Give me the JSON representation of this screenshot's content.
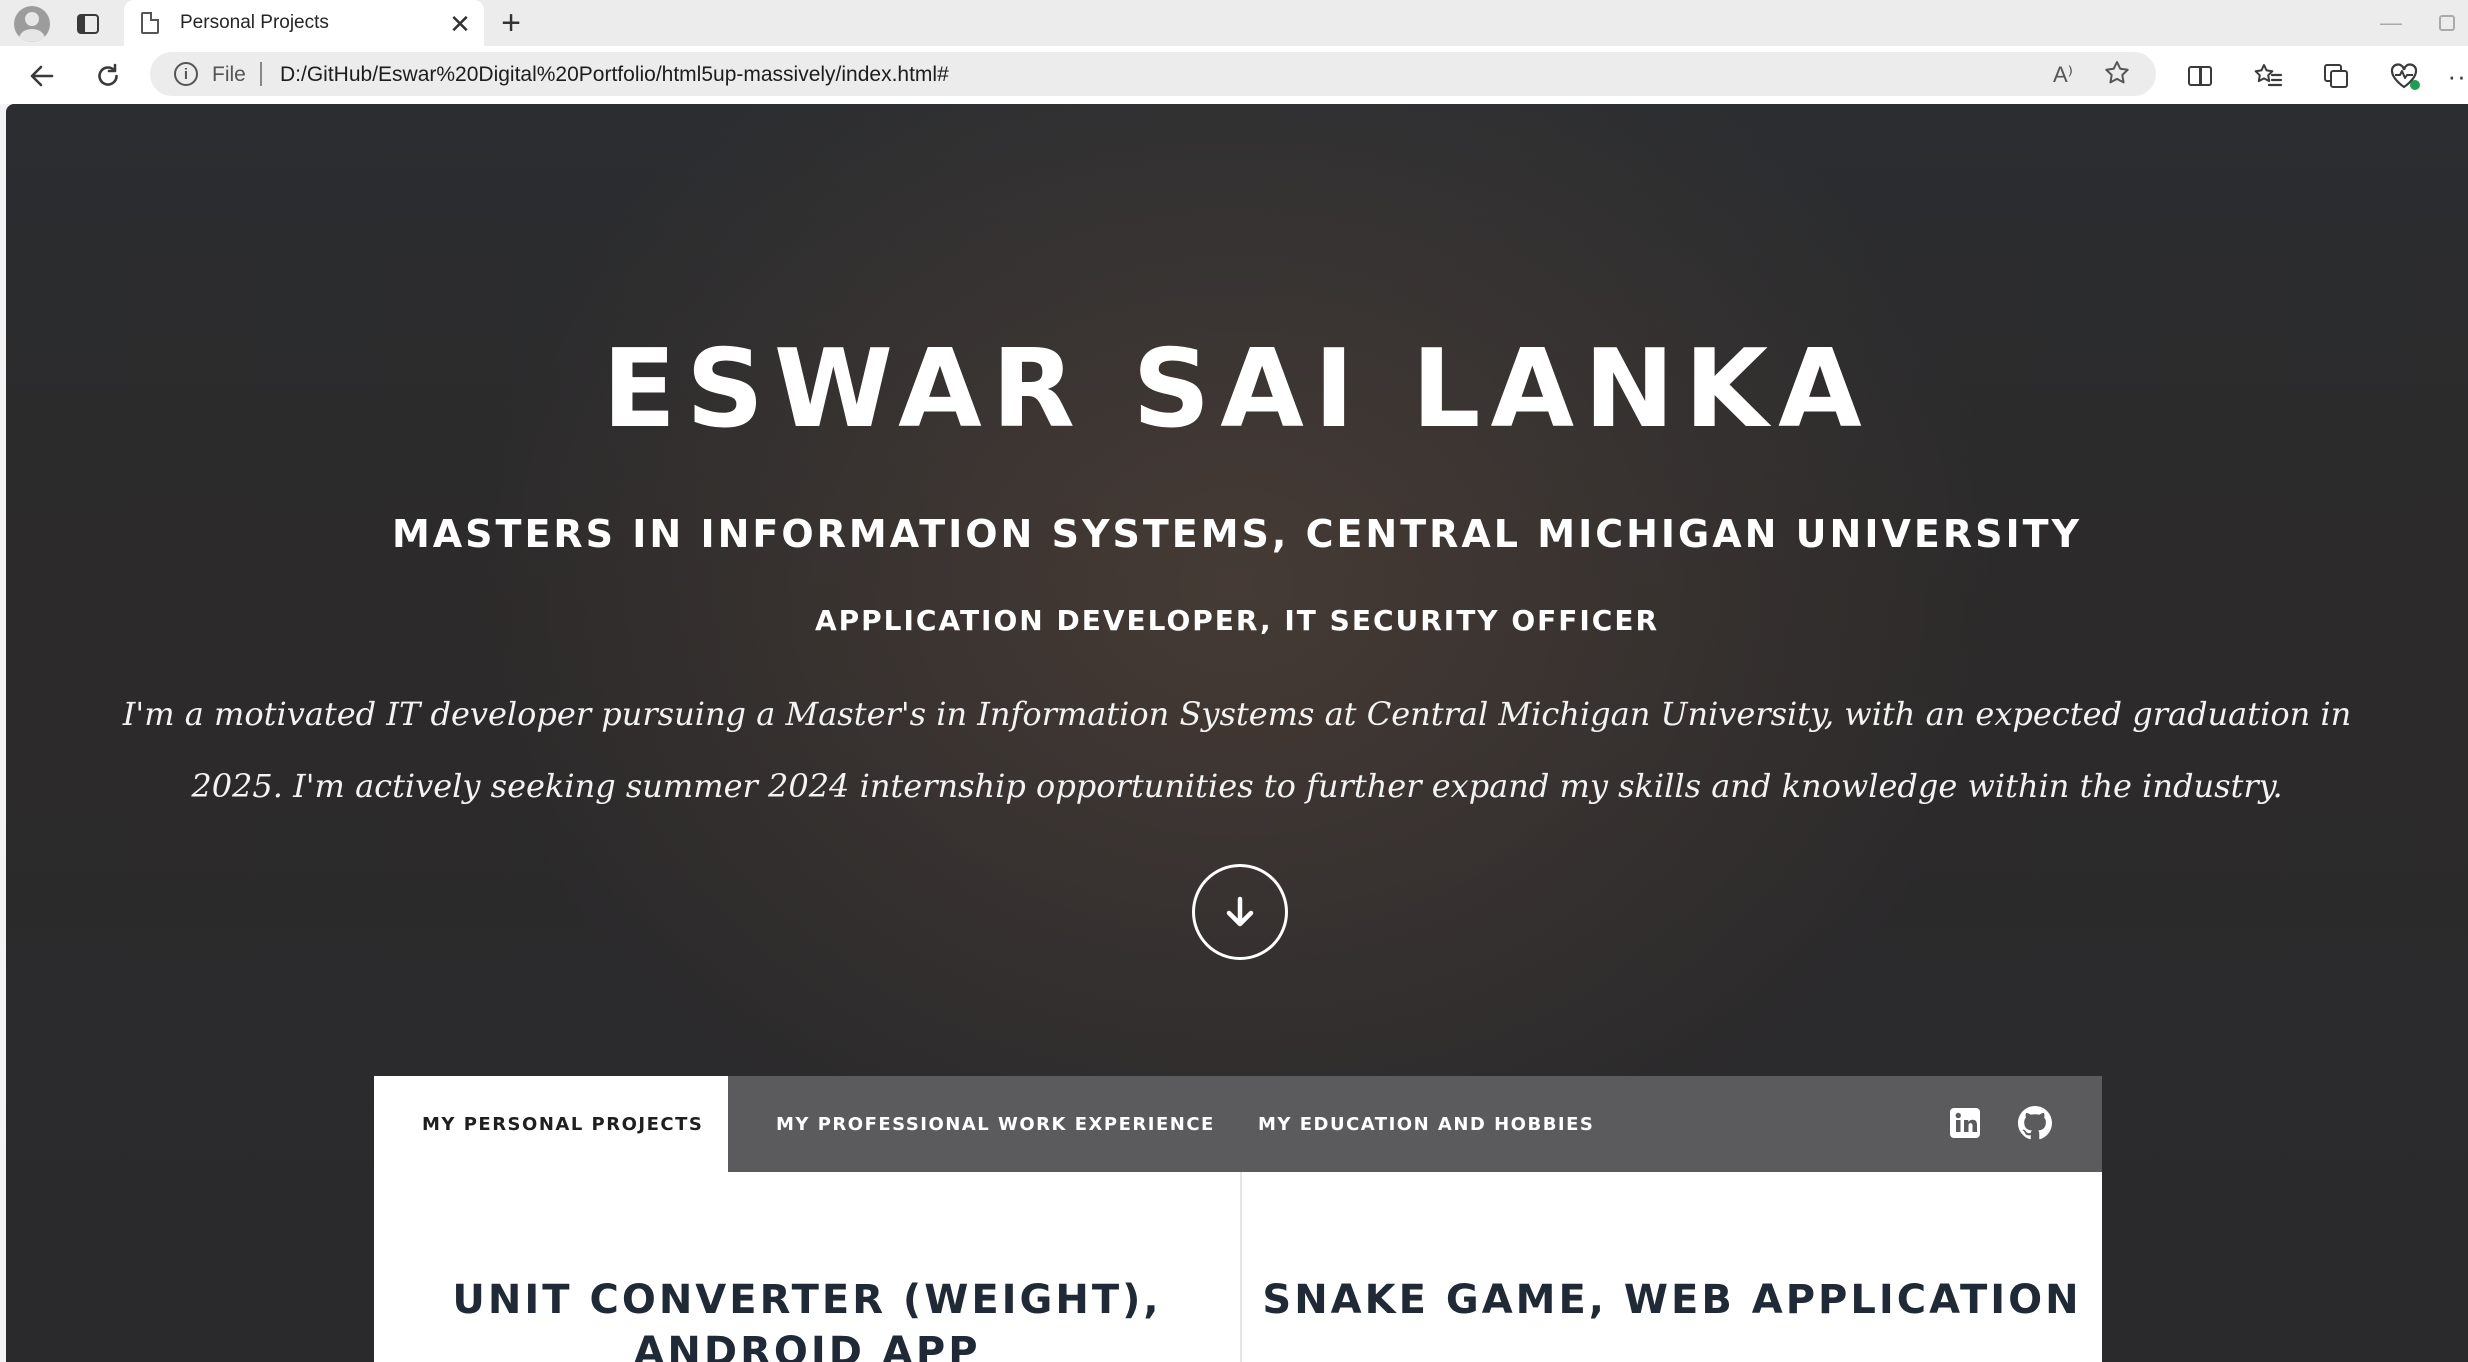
{
  "browser": {
    "tab_title": "Personal Projects",
    "file_label": "File",
    "url": "D:/GitHub/Eswar%20Digital%20Portfolio/html5up-massively/index.html#",
    "read_aloud_glyph": "A⁾",
    "close_glyph": "✕",
    "new_tab_glyph": "+",
    "info_glyph": "i",
    "minimize_glyph": "—",
    "more_glyph": "···"
  },
  "hero": {
    "name": "ESWAR SAI LANKA",
    "degree": "MASTERS IN INFORMATION SYSTEMS, CENTRAL MICHIGAN UNIVERSITY",
    "role": "APPLICATION DEVELOPER, IT SECURITY OFFICER",
    "bio": "I'm a motivated IT developer pursuing a Master's in Information Systems at Central Michigan University, with an expected graduation in 2025. I'm actively seeking summer 2024 internship opportunities to further expand my skills and knowledge within the industry."
  },
  "nav": {
    "tabs": [
      {
        "label": "MY PERSONAL PROJECTS",
        "active": true
      },
      {
        "label": "MY PROFESSIONAL WORK EXPERIENCE",
        "active": false
      },
      {
        "label": "MY EDUCATION AND HOBBIES",
        "active": false
      }
    ],
    "icons": [
      "linkedin-icon",
      "github-icon"
    ]
  },
  "projects": [
    {
      "title": "UNIT CONVERTER (WEIGHT), ANDROID APP"
    },
    {
      "title": "SNAKE GAME, WEB APPLICATION"
    }
  ],
  "colors": {
    "nav_bg": "#5b5b5d",
    "active_tab_bg": "#ffffff",
    "hero_text": "#ffffff",
    "project_title": "#1f2a36"
  }
}
